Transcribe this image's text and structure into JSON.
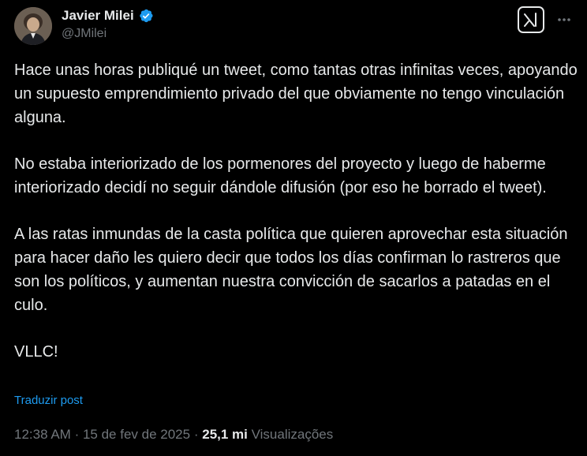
{
  "author": {
    "name": "Javier Milei",
    "handle": "@JMilei",
    "verified": true,
    "avatar_icon": "profile-photo",
    "verified_icon": "verified-badge-icon",
    "verified_color": "#1d9bf0"
  },
  "actions": {
    "grok_icon": "grok-icon",
    "more_icon": "more-horizontal-icon"
  },
  "tweet": {
    "paragraphs": [
      "Hace unas horas publiqué un tweet, como tantas otras infinitas veces, apoyando un supuesto emprendimiento privado del que obviamente no tengo vinculación alguna.",
      "No estaba interiorizado de los pormenores del proyecto y luego de haberme interiorizado decidí no seguir dándole difusión (por eso he borrado el tweet).",
      "A las ratas inmundas de la casta política que quieren aprovechar esta situación para hacer daño les quiero decir que todos los días confirman lo rastreros que son los políticos, y aumentan nuestra convicción de sacarlos a patadas en el culo.",
      "VLLC!"
    ],
    "translate_label": "Traduzir post"
  },
  "meta": {
    "time": "12:38 AM",
    "separator": "·",
    "date": "15 de fev de 2025",
    "views_count": "25,1 mi",
    "views_label": "Visualizações"
  },
  "colors": {
    "background": "#000000",
    "text": "#e7e9ea",
    "secondary": "#71767b",
    "accent": "#1d9bf0"
  }
}
